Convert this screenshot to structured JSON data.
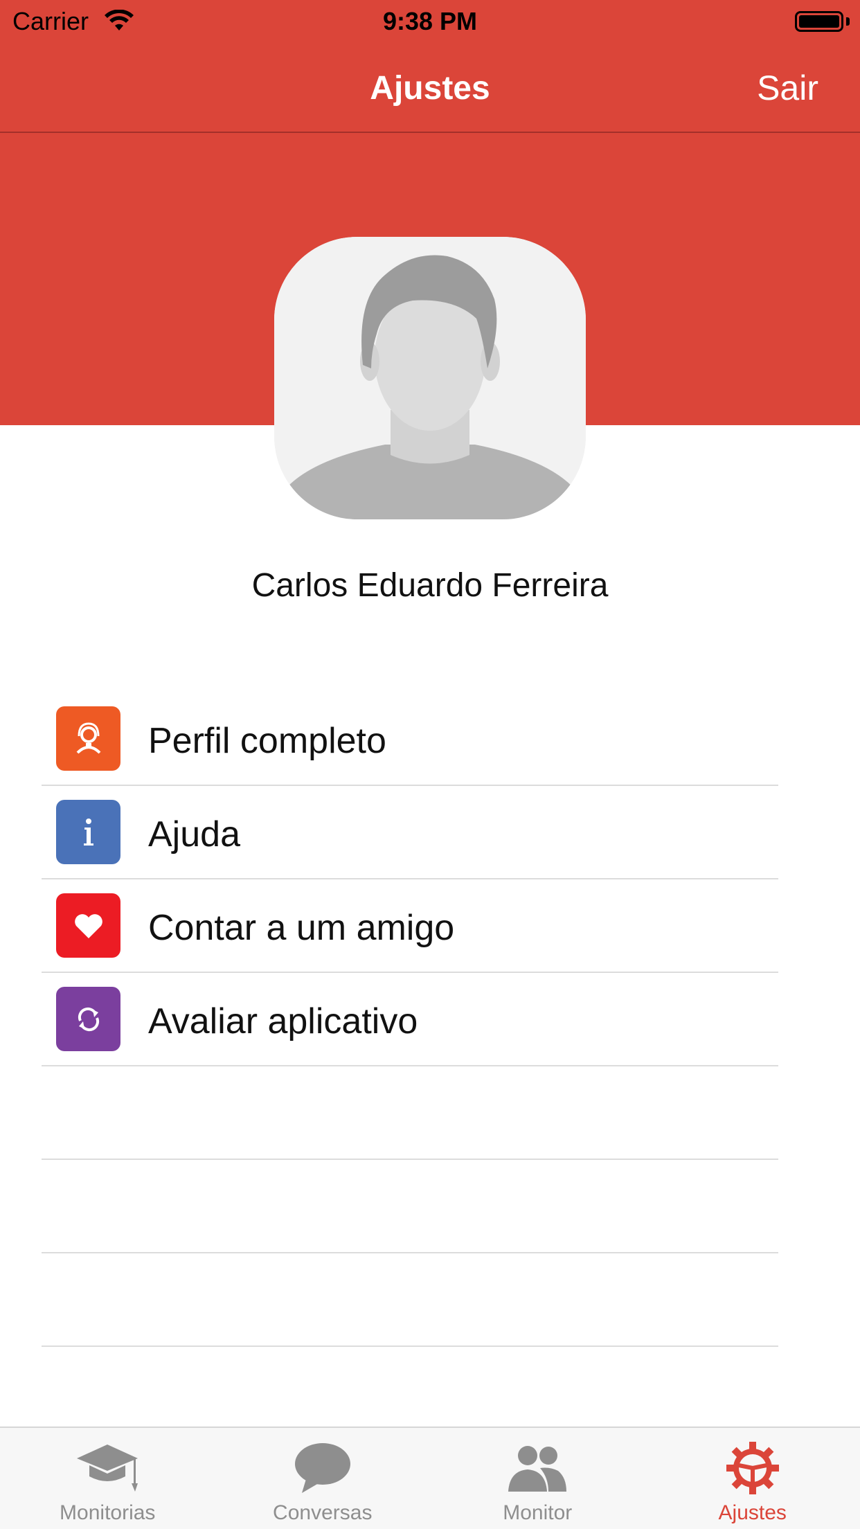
{
  "status_bar": {
    "carrier": "Carrier",
    "time": "9:38 PM"
  },
  "nav": {
    "title": "Ajustes",
    "logout_label": "Sair"
  },
  "profile": {
    "name": "Carlos Eduardo Ferreira",
    "avatar_icon": "default-person-avatar"
  },
  "menu": {
    "items": [
      {
        "label": "Perfil completo",
        "icon": "person-headset-icon",
        "color": "#ee5a24"
      },
      {
        "label": "Ajuda",
        "icon": "info-icon",
        "color": "#4a72b8"
      },
      {
        "label": "Contar a um amigo",
        "icon": "heart-icon",
        "color": "#ec1c24"
      },
      {
        "label": "Avaliar aplicativo",
        "icon": "refresh-icon",
        "color": "#7b3f9e"
      }
    ]
  },
  "tabs": [
    {
      "label": "Monitorias",
      "icon": "graduation-cap-icon",
      "active": false
    },
    {
      "label": "Conversas",
      "icon": "chat-bubble-icon",
      "active": false
    },
    {
      "label": "Monitor",
      "icon": "people-icon",
      "active": false
    },
    {
      "label": "Ajustes",
      "icon": "gear-icon",
      "active": true
    }
  ],
  "colors": {
    "brand": "#db4539",
    "tab_inactive": "#8e8e8e"
  }
}
